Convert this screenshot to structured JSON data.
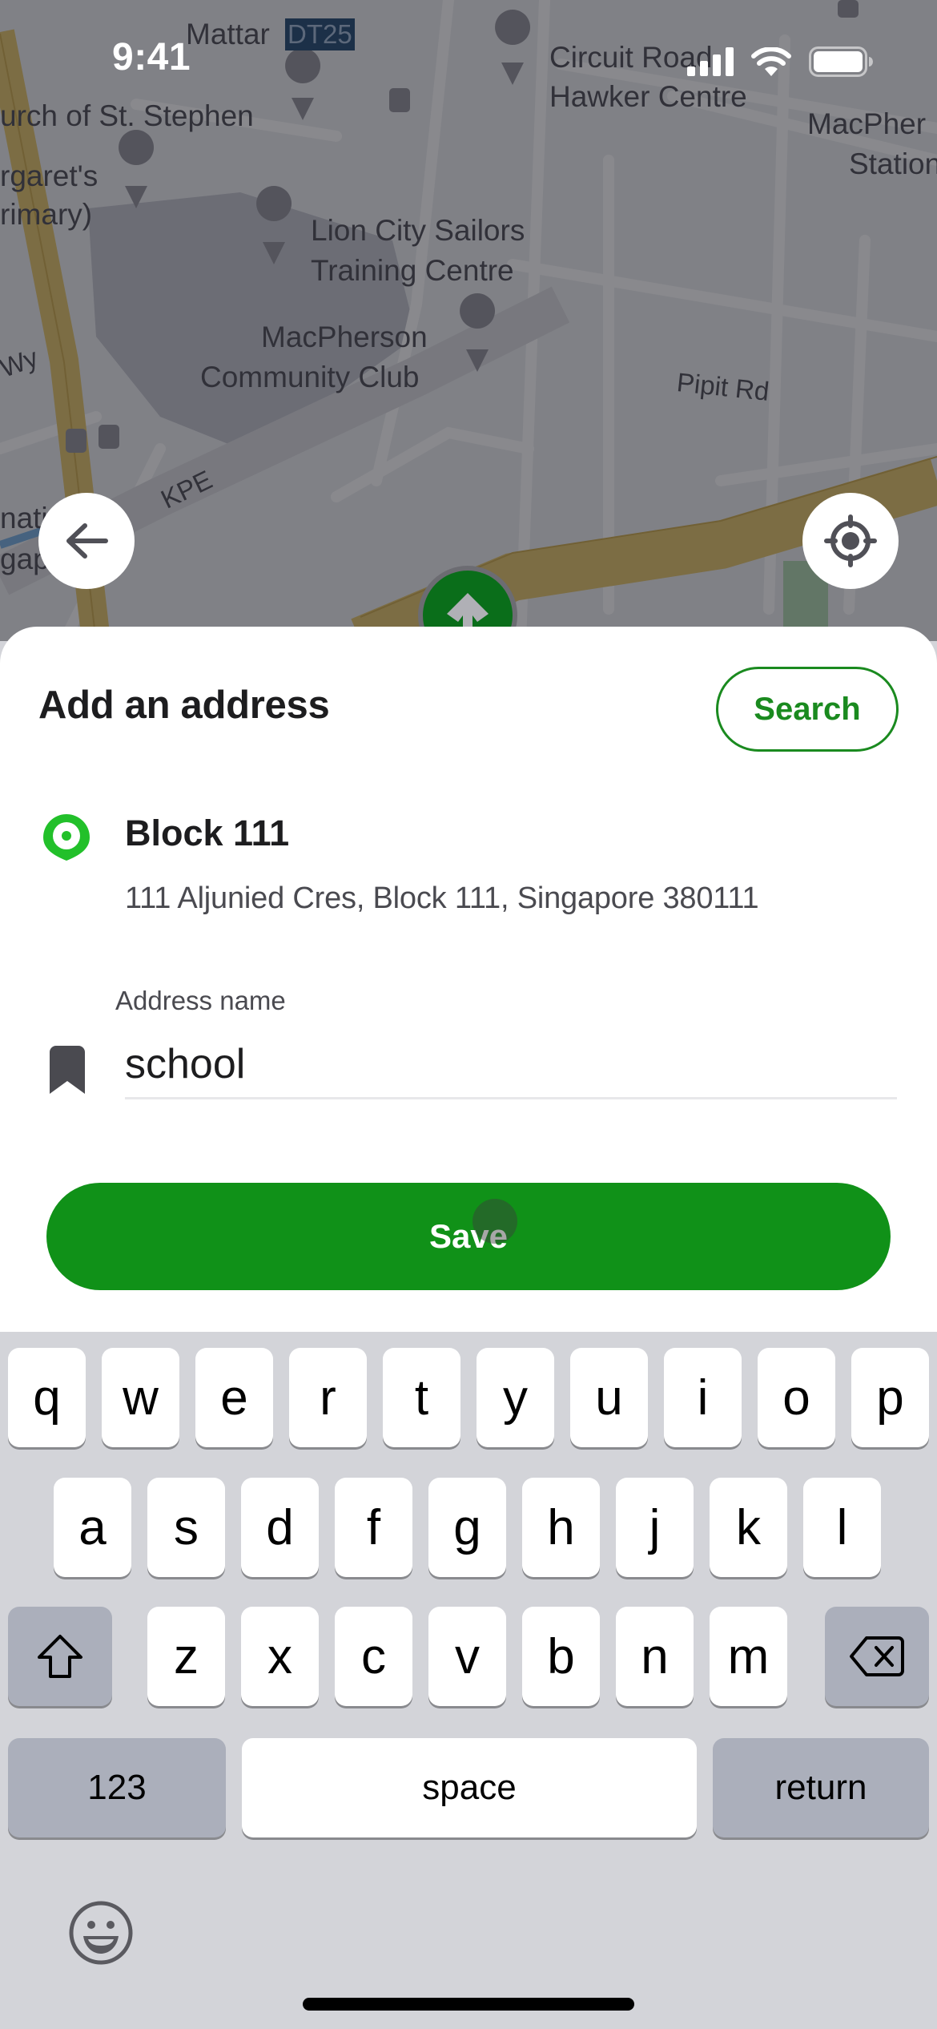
{
  "status_bar": {
    "time": "9:41",
    "icons": [
      "cellular-signal-icon",
      "wifi-icon",
      "battery-icon"
    ]
  },
  "map": {
    "labels": [
      {
        "text": "Mattar",
        "kind": "place"
      },
      {
        "text": "DT25",
        "kind": "station-code"
      },
      {
        "text": "urch of St. Stephen",
        "kind": "place"
      },
      {
        "text": "Circuit Road",
        "kind": "place"
      },
      {
        "text": "Hawker Centre",
        "kind": "place"
      },
      {
        "text": "MacPher",
        "kind": "place"
      },
      {
        "text": "Station",
        "kind": "place"
      },
      {
        "text": "rgaret's",
        "kind": "place"
      },
      {
        "text": "rimary)",
        "kind": "place"
      },
      {
        "text": "Lion City Sailors",
        "kind": "place"
      },
      {
        "text": "Training Centre",
        "kind": "place"
      },
      {
        "text": "MacPherson",
        "kind": "place"
      },
      {
        "text": "Community Club",
        "kind": "place"
      },
      {
        "text": "Pipit Rd",
        "kind": "road"
      },
      {
        "text": "Wy",
        "kind": "road"
      },
      {
        "text": "KPE",
        "kind": "road"
      },
      {
        "text": "natic",
        "kind": "place"
      },
      {
        "text": "gap",
        "kind": "place"
      }
    ],
    "back_button": "back-arrow-icon",
    "locate_button": "my-location-icon"
  },
  "sheet": {
    "title": "Add an address",
    "search_label": "Search",
    "location": {
      "title": "Block 111",
      "address": "111 Aljunied Cres, Block 111, Singapore 380111"
    },
    "address_name": {
      "label": "Address name",
      "value": "school"
    },
    "save_label": "Save"
  },
  "colors": {
    "brand_green": "#109118",
    "search_green": "#1a8a1f",
    "pin_green": "#22c02a",
    "keyboard_bg": "#d3d4d9",
    "key_dark": "#abafbb"
  },
  "keyboard": {
    "row1": [
      "q",
      "w",
      "e",
      "r",
      "t",
      "y",
      "u",
      "i",
      "o",
      "p"
    ],
    "row2": [
      "a",
      "s",
      "d",
      "f",
      "g",
      "h",
      "j",
      "k",
      "l"
    ],
    "row3": [
      "z",
      "x",
      "c",
      "v",
      "b",
      "n",
      "m"
    ],
    "numbers_label": "123",
    "space_label": "space",
    "return_label": "return"
  }
}
